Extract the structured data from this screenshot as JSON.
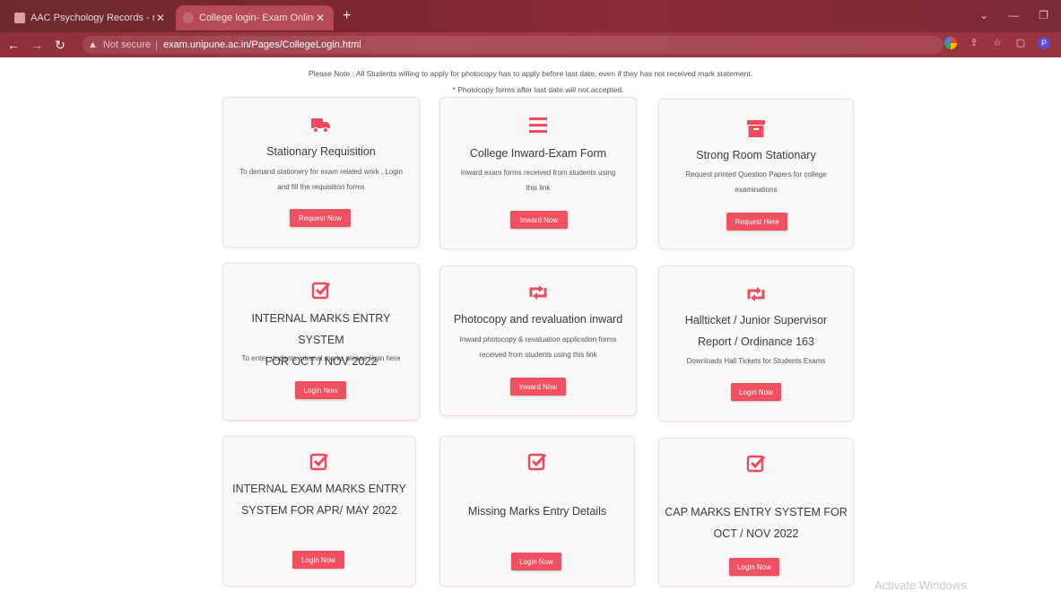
{
  "browser": {
    "tabs": [
      {
        "title": "AAC Psychology Records - msc"
      },
      {
        "title": "College login- Exam Online, Ex"
      }
    ],
    "new_tab": "+",
    "url_prefix": "Not secure",
    "url": "exam.unipune.ac.in/Pages/CollegeLogin.html",
    "profile_initial": "P"
  },
  "notes": {
    "note1": "Please Note : All Students willing to apply for photocopy has to apply before last date, even if they has not received mark statement.",
    "note2": "* Photocopy forms after last date will not accepted."
  },
  "cards": [
    {
      "icon": "truck-icon",
      "title_lines": [
        "Stationary Requisition"
      ],
      "desc_lines": [
        "To demand stationery for exam related work , Login",
        "and fill the requisition forms"
      ],
      "button": "Request Now"
    },
    {
      "icon": "menu-icon",
      "title_lines": [
        "College Inward-Exam Form"
      ],
      "desc_lines": [
        "Inward exam forms received from students using",
        "this link"
      ],
      "button": "Inward Now"
    },
    {
      "icon": "archive-icon",
      "title_lines": [
        "Strong Room Stationary"
      ],
      "desc_lines": [
        "Request printed Question Papers for college",
        "examinations"
      ],
      "button": "Request Here"
    },
    {
      "icon": "checkbox-icon",
      "title_lines": [
        "INTERNAL MARKS ENTRY SYSTEM",
        "FOR OCT / NOV 2022"
      ],
      "desc_lines": [
        "To enter students internal marks please login here"
      ],
      "button": "Login Now"
    },
    {
      "icon": "retweet-icon",
      "title_lines": [
        "Photocopy and revaluation inward"
      ],
      "desc_lines": [
        "Inward photocopy & revaluation application forms",
        "received from students using this link"
      ],
      "button": "Inward Now"
    },
    {
      "icon": "retweet-icon",
      "title_lines": [
        "Hallticket / Junior Supervisor",
        "Report / Ordinance 163"
      ],
      "desc_lines": [
        "Downloads Hall Tickets for Students Exams"
      ],
      "button": "Login Now"
    },
    {
      "icon": "checkbox-icon",
      "title_lines": [
        "INTERNAL EXAM MARKS ENTRY",
        "SYSTEM FOR APR/ MAY 2022"
      ],
      "desc_lines": [],
      "button": "Login Now"
    },
    {
      "icon": "checkbox-icon",
      "title_lines": [
        "Missing Marks Entry Details"
      ],
      "desc_lines": [],
      "button": "Login Now"
    },
    {
      "icon": "checkbox-icon",
      "title_lines": [
        "CAP MARKS ENTRY SYSTEM FOR",
        "OCT / NOV 2022"
      ],
      "desc_lines": [],
      "button": "Login Now"
    }
  ],
  "watermark": "Activate Windows"
}
